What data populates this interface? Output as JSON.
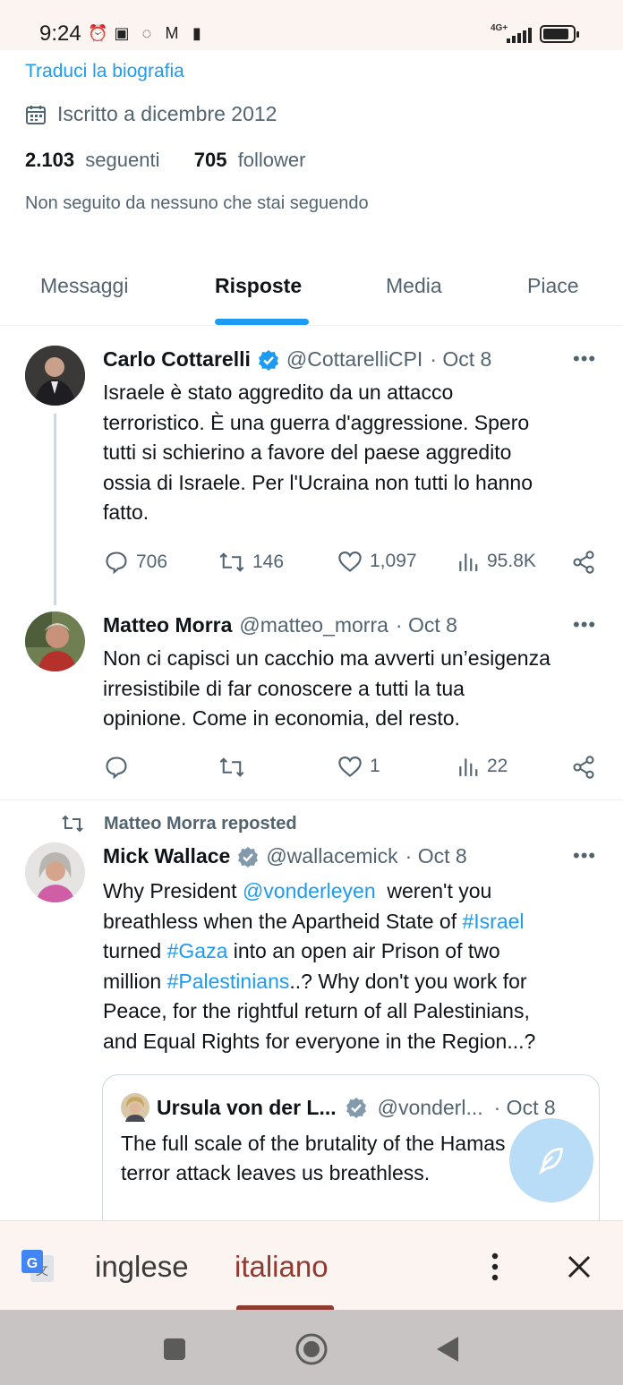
{
  "status_bar": {
    "time": "9:24",
    "network": "4G+",
    "icons": [
      "alarm-icon",
      "nfc-icon",
      "whatsapp-icon",
      "gmail-icon",
      "sim-icon"
    ]
  },
  "profile": {
    "translate_bio": "Traduci la biografia",
    "joined": "Iscritto a dicembre 2012",
    "following_count": "2.103",
    "following_label": "seguenti",
    "followers_count": "705",
    "followers_label": "follower",
    "not_followed": "Non seguito da nessuno che stai seguendo"
  },
  "tabs": [
    {
      "label": "Messaggi",
      "active": false
    },
    {
      "label": "Risposte",
      "active": true
    },
    {
      "label": "Media",
      "active": false
    },
    {
      "label": "Piace",
      "active": false
    }
  ],
  "tweets": [
    {
      "name": "Carlo Cottarelli",
      "handle": "@CottarelliCPI",
      "date": "· Oct 8",
      "verified": true,
      "text_lines": [
        "Israele è stato aggredito da un attacco",
        "terroristico. È una guerra d'aggressione. Spero",
        "tutti si schierino a favore del paese aggredito",
        "ossia di Israele. Per l'Ucraina non tutti lo hanno",
        "fatto."
      ],
      "replies": "706",
      "reposts": "146",
      "likes": "1,097",
      "views": "95.8K"
    },
    {
      "name": "Matteo Morra",
      "handle": "@matteo_morra",
      "date": "· Oct 8",
      "verified": false,
      "text_lines": [
        "Non ci capisci un cacchio ma avverti un’esigenza",
        "irresistibile di far conoscere a tutti la tua",
        "opinione. Come in economia, del resto."
      ],
      "replies": "",
      "reposts": "",
      "likes": "1",
      "views": "22"
    },
    {
      "repost_label": "Matteo Morra reposted",
      "name": "Mick Wallace",
      "handle": "@wallacemick",
      "date": "· Oct 8",
      "verified": true,
      "text": {
        "l1a": "Why President ",
        "l1link": "@vonderleyen",
        "l1b": "  weren't you",
        "l2a": "breathless when the Apartheid State of ",
        "l2link": "#Israel",
        "l3a": "turned ",
        "l3link": "#Gaza",
        "l3b": " into an open air Prison of two",
        "l4a": "million ",
        "l4link": "#Palestinians",
        "l4b": "..? Why don't you work for",
        "l5": "Peace, for the rightful return of all Palestinians,",
        "l6": "and Equal Rights for everyone in the Region...?"
      },
      "quote": {
        "name": "Ursula von der L...",
        "handle": "@vonderl...",
        "date": "· Oct 8",
        "text_lines": [
          "The full scale of the brutality of the Hamas",
          "terror attack leaves us breathless."
        ]
      }
    }
  ],
  "translate_bar": {
    "source_lang": "inglese",
    "target_lang": "italiano"
  },
  "colors": {
    "accent": "#1d9bf0",
    "secondary_text": "#536471",
    "translate_accent": "#8f3b32"
  }
}
